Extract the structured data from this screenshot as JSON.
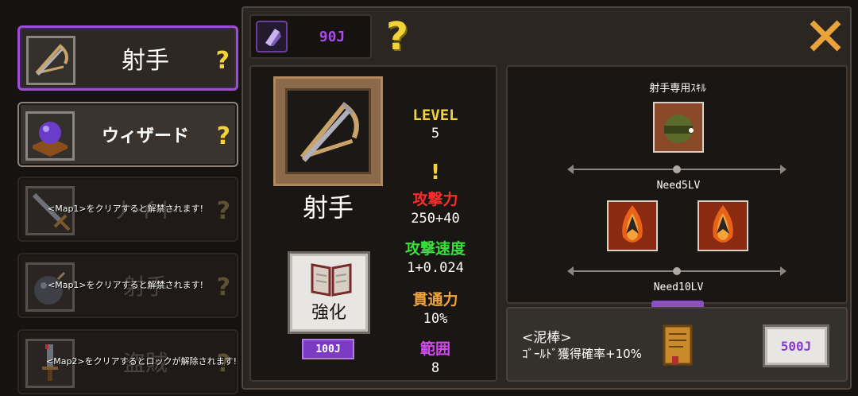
{
  "jobs": [
    {
      "name": "射手",
      "help": "?",
      "selected": true,
      "icon": "crossbow-icon"
    },
    {
      "name": "ウィザード",
      "help": "?",
      "icon": "magic-orb-icon"
    },
    {
      "name": "ナイト",
      "help": "?",
      "locked": true,
      "lock_message": "<Map1>をクリアすると解禁されます!",
      "icon": "sword-icon"
    },
    {
      "name": "射手",
      "help": "?",
      "locked": true,
      "lock_message": "<Map1>をクリアすると解禁されます!",
      "icon": "bomb-icon"
    },
    {
      "name": "盗賊",
      "help": "?",
      "locked": true,
      "lock_message": "<Map2>をクリアするとロックが解除されます!",
      "icon": "dagger-icon"
    }
  ],
  "currency": {
    "amount": "90J",
    "icon": "purple-gem-icon"
  },
  "help_big": "?",
  "hero": {
    "name": "射手",
    "icon": "crossbow-icon"
  },
  "upgrade": {
    "label": "強化",
    "cost": "100J",
    "icon": "book-icon"
  },
  "stats": {
    "level_label": "LEVEL",
    "level_value": "5",
    "alert": "!",
    "attack_label": "攻撃力",
    "attack_value": "250+40",
    "speed_label": "攻撃速度",
    "speed_value": "1+0.024",
    "pierce_label": "貫通力",
    "pierce_value": "10%",
    "range_label": "範囲",
    "range_value": "8"
  },
  "skills": {
    "title": "射手専用ｽｷﾙ",
    "need1": "Need5LV",
    "need2": "Need10LV"
  },
  "item": {
    "line1": "<泥棒>",
    "line2": "ｺﾞｰﾙﾄﾞ獲得確率+10%",
    "cost": "500J",
    "icon": "scroll-icon"
  },
  "colors": {
    "accent_purple": "#9a4fd6",
    "gold": "#f2d33a",
    "attack_red": "#ff2a2a",
    "speed_green": "#34e23a",
    "pierce_orange": "#f2a43a",
    "range_magenta": "#d24af0"
  }
}
